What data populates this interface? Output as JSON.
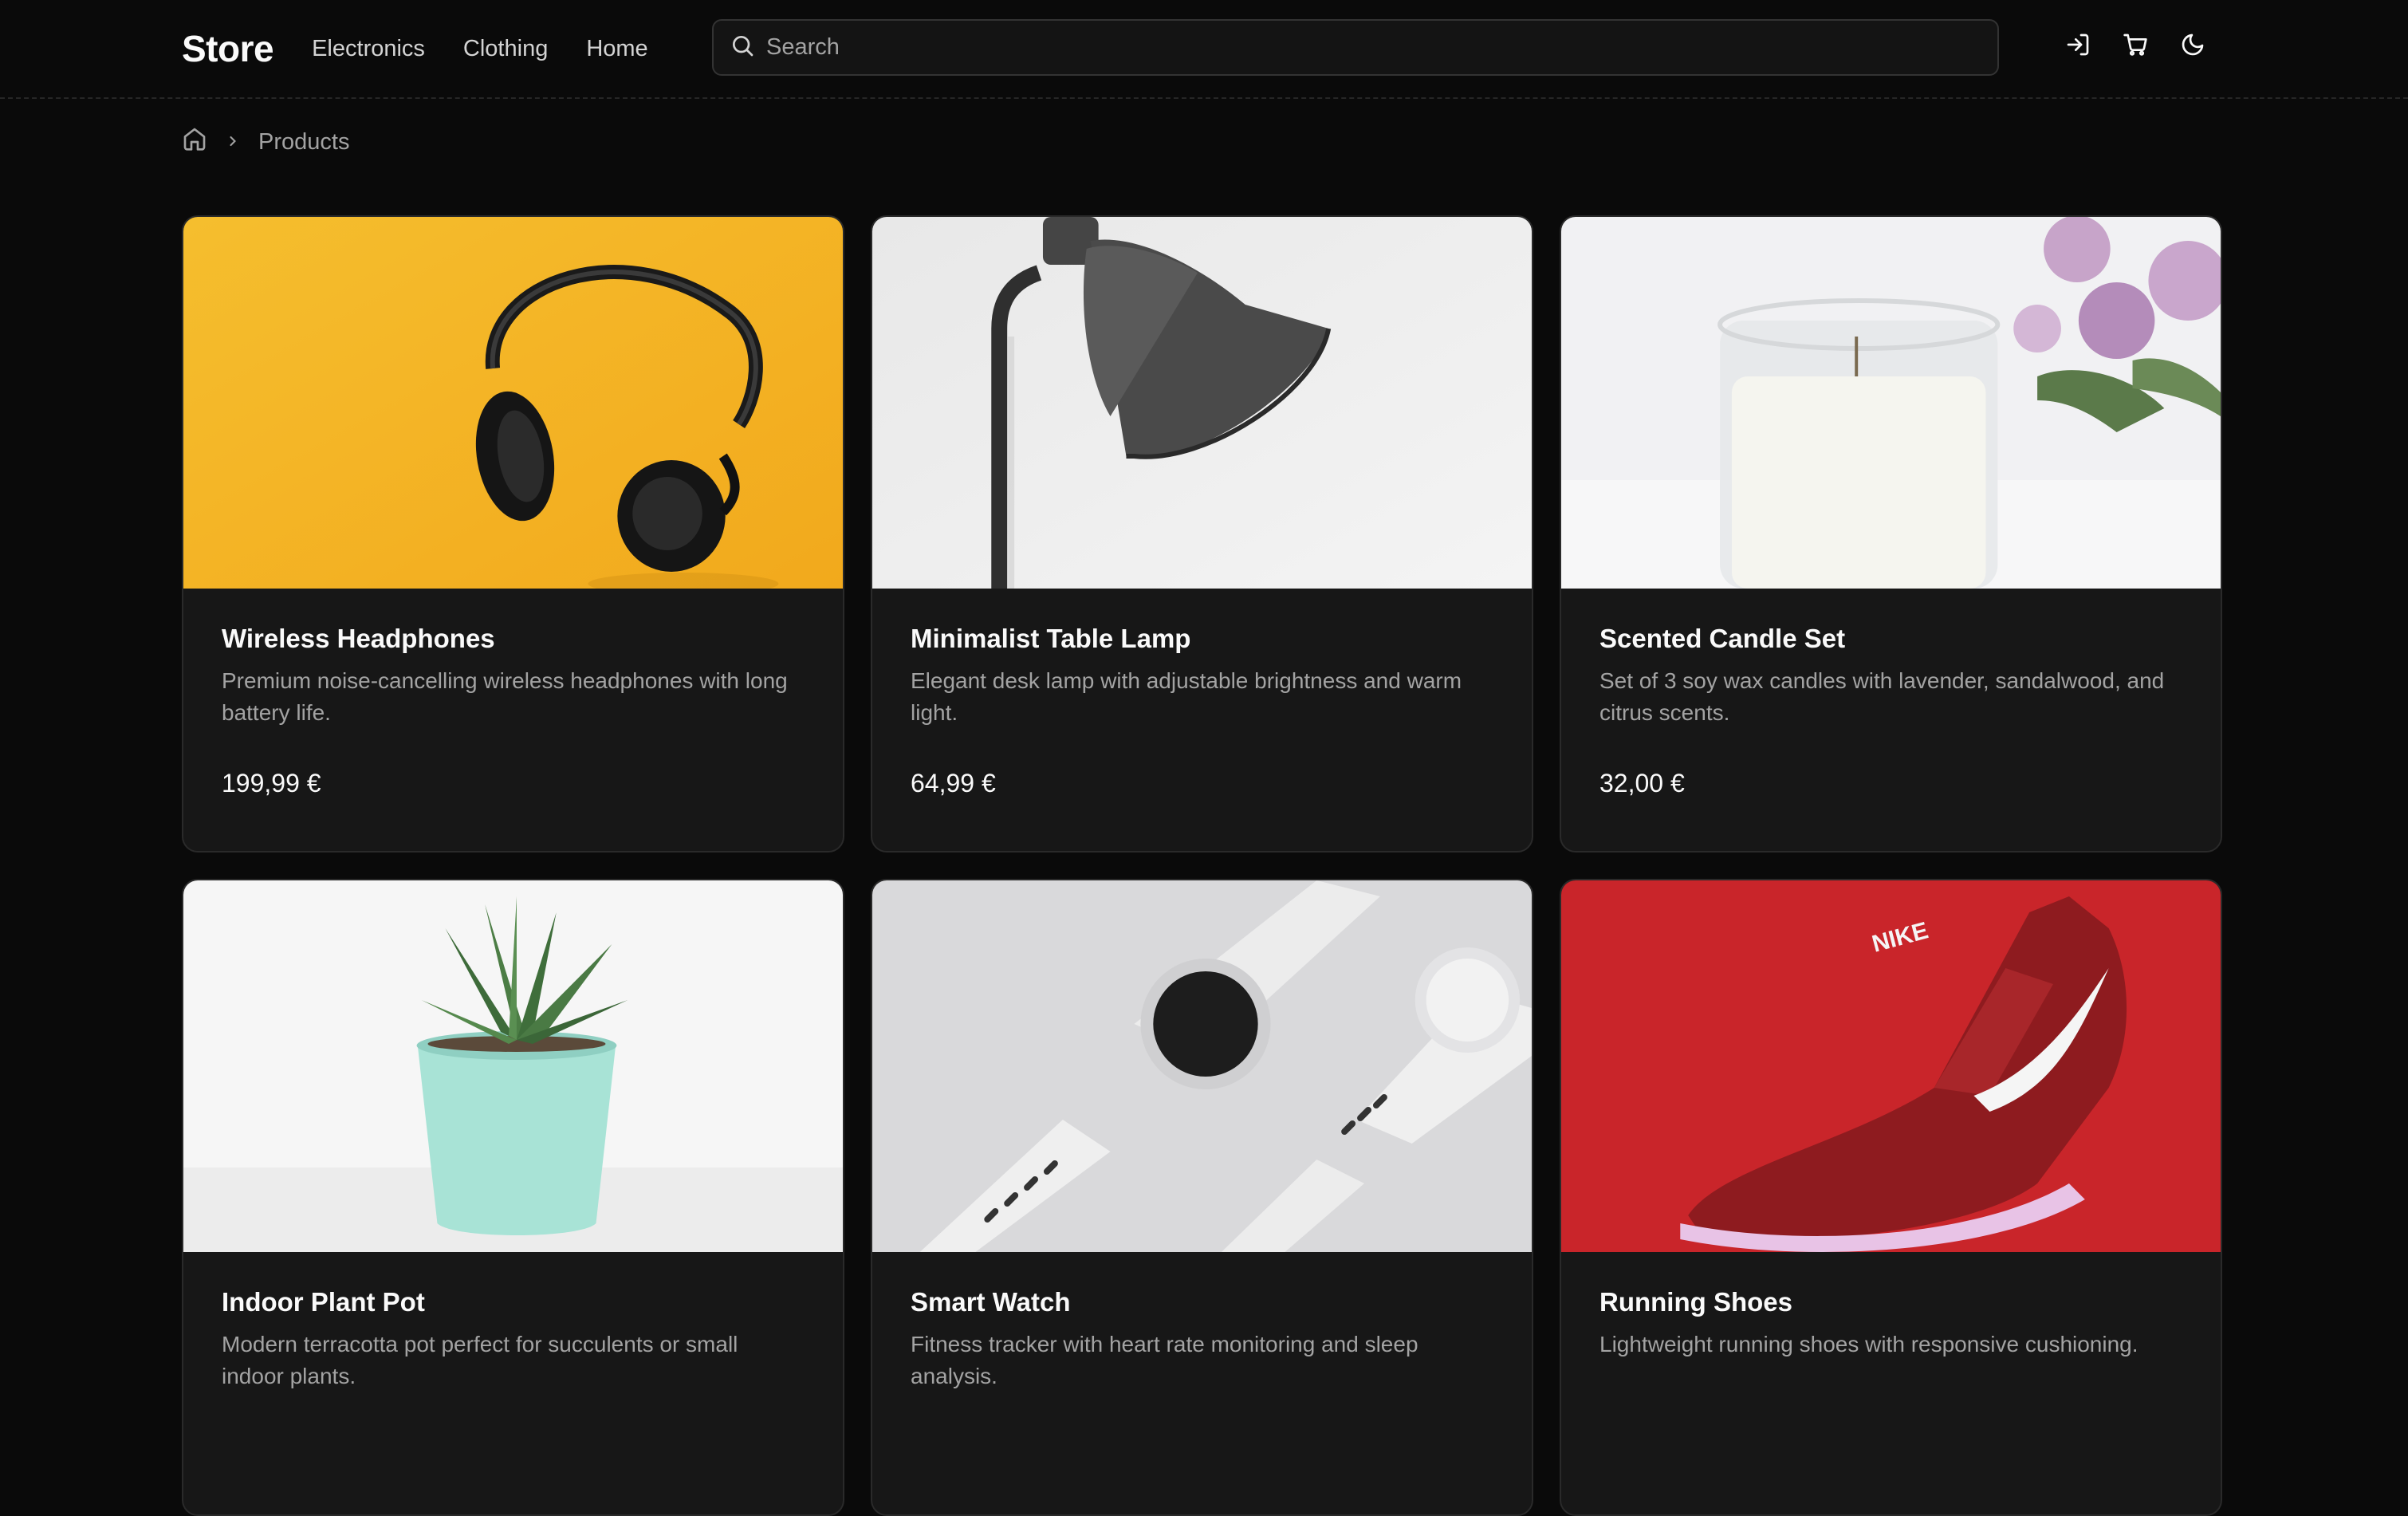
{
  "header": {
    "logo": "Store",
    "nav": [
      "Electronics",
      "Clothing",
      "Home"
    ],
    "search_placeholder": "Search",
    "icons": [
      "login-icon",
      "cart-icon",
      "moon-icon"
    ]
  },
  "breadcrumb": {
    "items": [
      "Products"
    ]
  },
  "products": [
    {
      "title": "Wireless Headphones",
      "desc": "Premium noise-cancelling wireless headphones with long battery life.",
      "price": "199,99 €",
      "image": "headphones-image"
    },
    {
      "title": "Minimalist Table Lamp",
      "desc": "Elegant desk lamp with adjustable brightness and warm light.",
      "price": "64,99 €",
      "image": "lamp-image"
    },
    {
      "title": "Scented Candle Set",
      "desc": "Set of 3 soy wax candles with lavender, sandalwood, and citrus scents.",
      "price": "32,00 €",
      "image": "candle-image"
    },
    {
      "title": "Indoor Plant Pot",
      "desc": "Modern terracotta pot perfect for succulents or small indoor plants.",
      "price": "",
      "image": "plant-image"
    },
    {
      "title": "Smart Watch",
      "desc": "Fitness tracker with heart rate monitoring and sleep analysis.",
      "price": "",
      "image": "watch-image"
    },
    {
      "title": "Running Shoes",
      "desc": "Lightweight running shoes with responsive cushioning.",
      "price": "",
      "image": "shoe-image"
    }
  ],
  "colors": {
    "background": "#0a0a0a",
    "card": "#171717",
    "border": "#2a2a2a",
    "muted_text": "#a3a3a3"
  }
}
